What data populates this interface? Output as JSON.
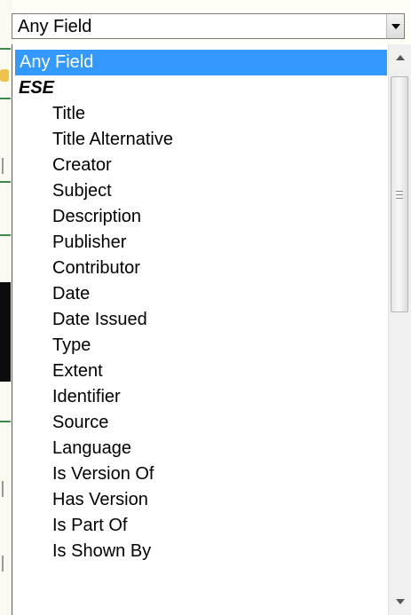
{
  "select": {
    "value": "Any Field",
    "arrow_icon": "dropdown-arrow-icon"
  },
  "dropdown": {
    "options": [
      {
        "label": "Any Field",
        "kind": "selected"
      },
      {
        "label": "ESE",
        "kind": "group"
      },
      {
        "label": "Title",
        "kind": "child"
      },
      {
        "label": "Title Alternative",
        "kind": "child"
      },
      {
        "label": "Creator",
        "kind": "child"
      },
      {
        "label": "Subject",
        "kind": "child"
      },
      {
        "label": "Description",
        "kind": "child"
      },
      {
        "label": "Publisher",
        "kind": "child"
      },
      {
        "label": "Contributor",
        "kind": "child"
      },
      {
        "label": "Date",
        "kind": "child"
      },
      {
        "label": "Date Issued",
        "kind": "child"
      },
      {
        "label": "Type",
        "kind": "child"
      },
      {
        "label": "Extent",
        "kind": "child"
      },
      {
        "label": "Identifier",
        "kind": "child"
      },
      {
        "label": "Source",
        "kind": "child"
      },
      {
        "label": "Language",
        "kind": "child"
      },
      {
        "label": "Is Version Of",
        "kind": "child"
      },
      {
        "label": "Has Version",
        "kind": "child"
      },
      {
        "label": "Is Part Of",
        "kind": "child"
      },
      {
        "label": "Is Shown By",
        "kind": "child"
      }
    ],
    "selection_color": "#3399ff",
    "scrollbar": {
      "up_icon": "scroll-up-arrow-icon",
      "down_icon": "scroll-down-arrow-icon",
      "thumb_icon": "scroll-grip-icon"
    }
  }
}
